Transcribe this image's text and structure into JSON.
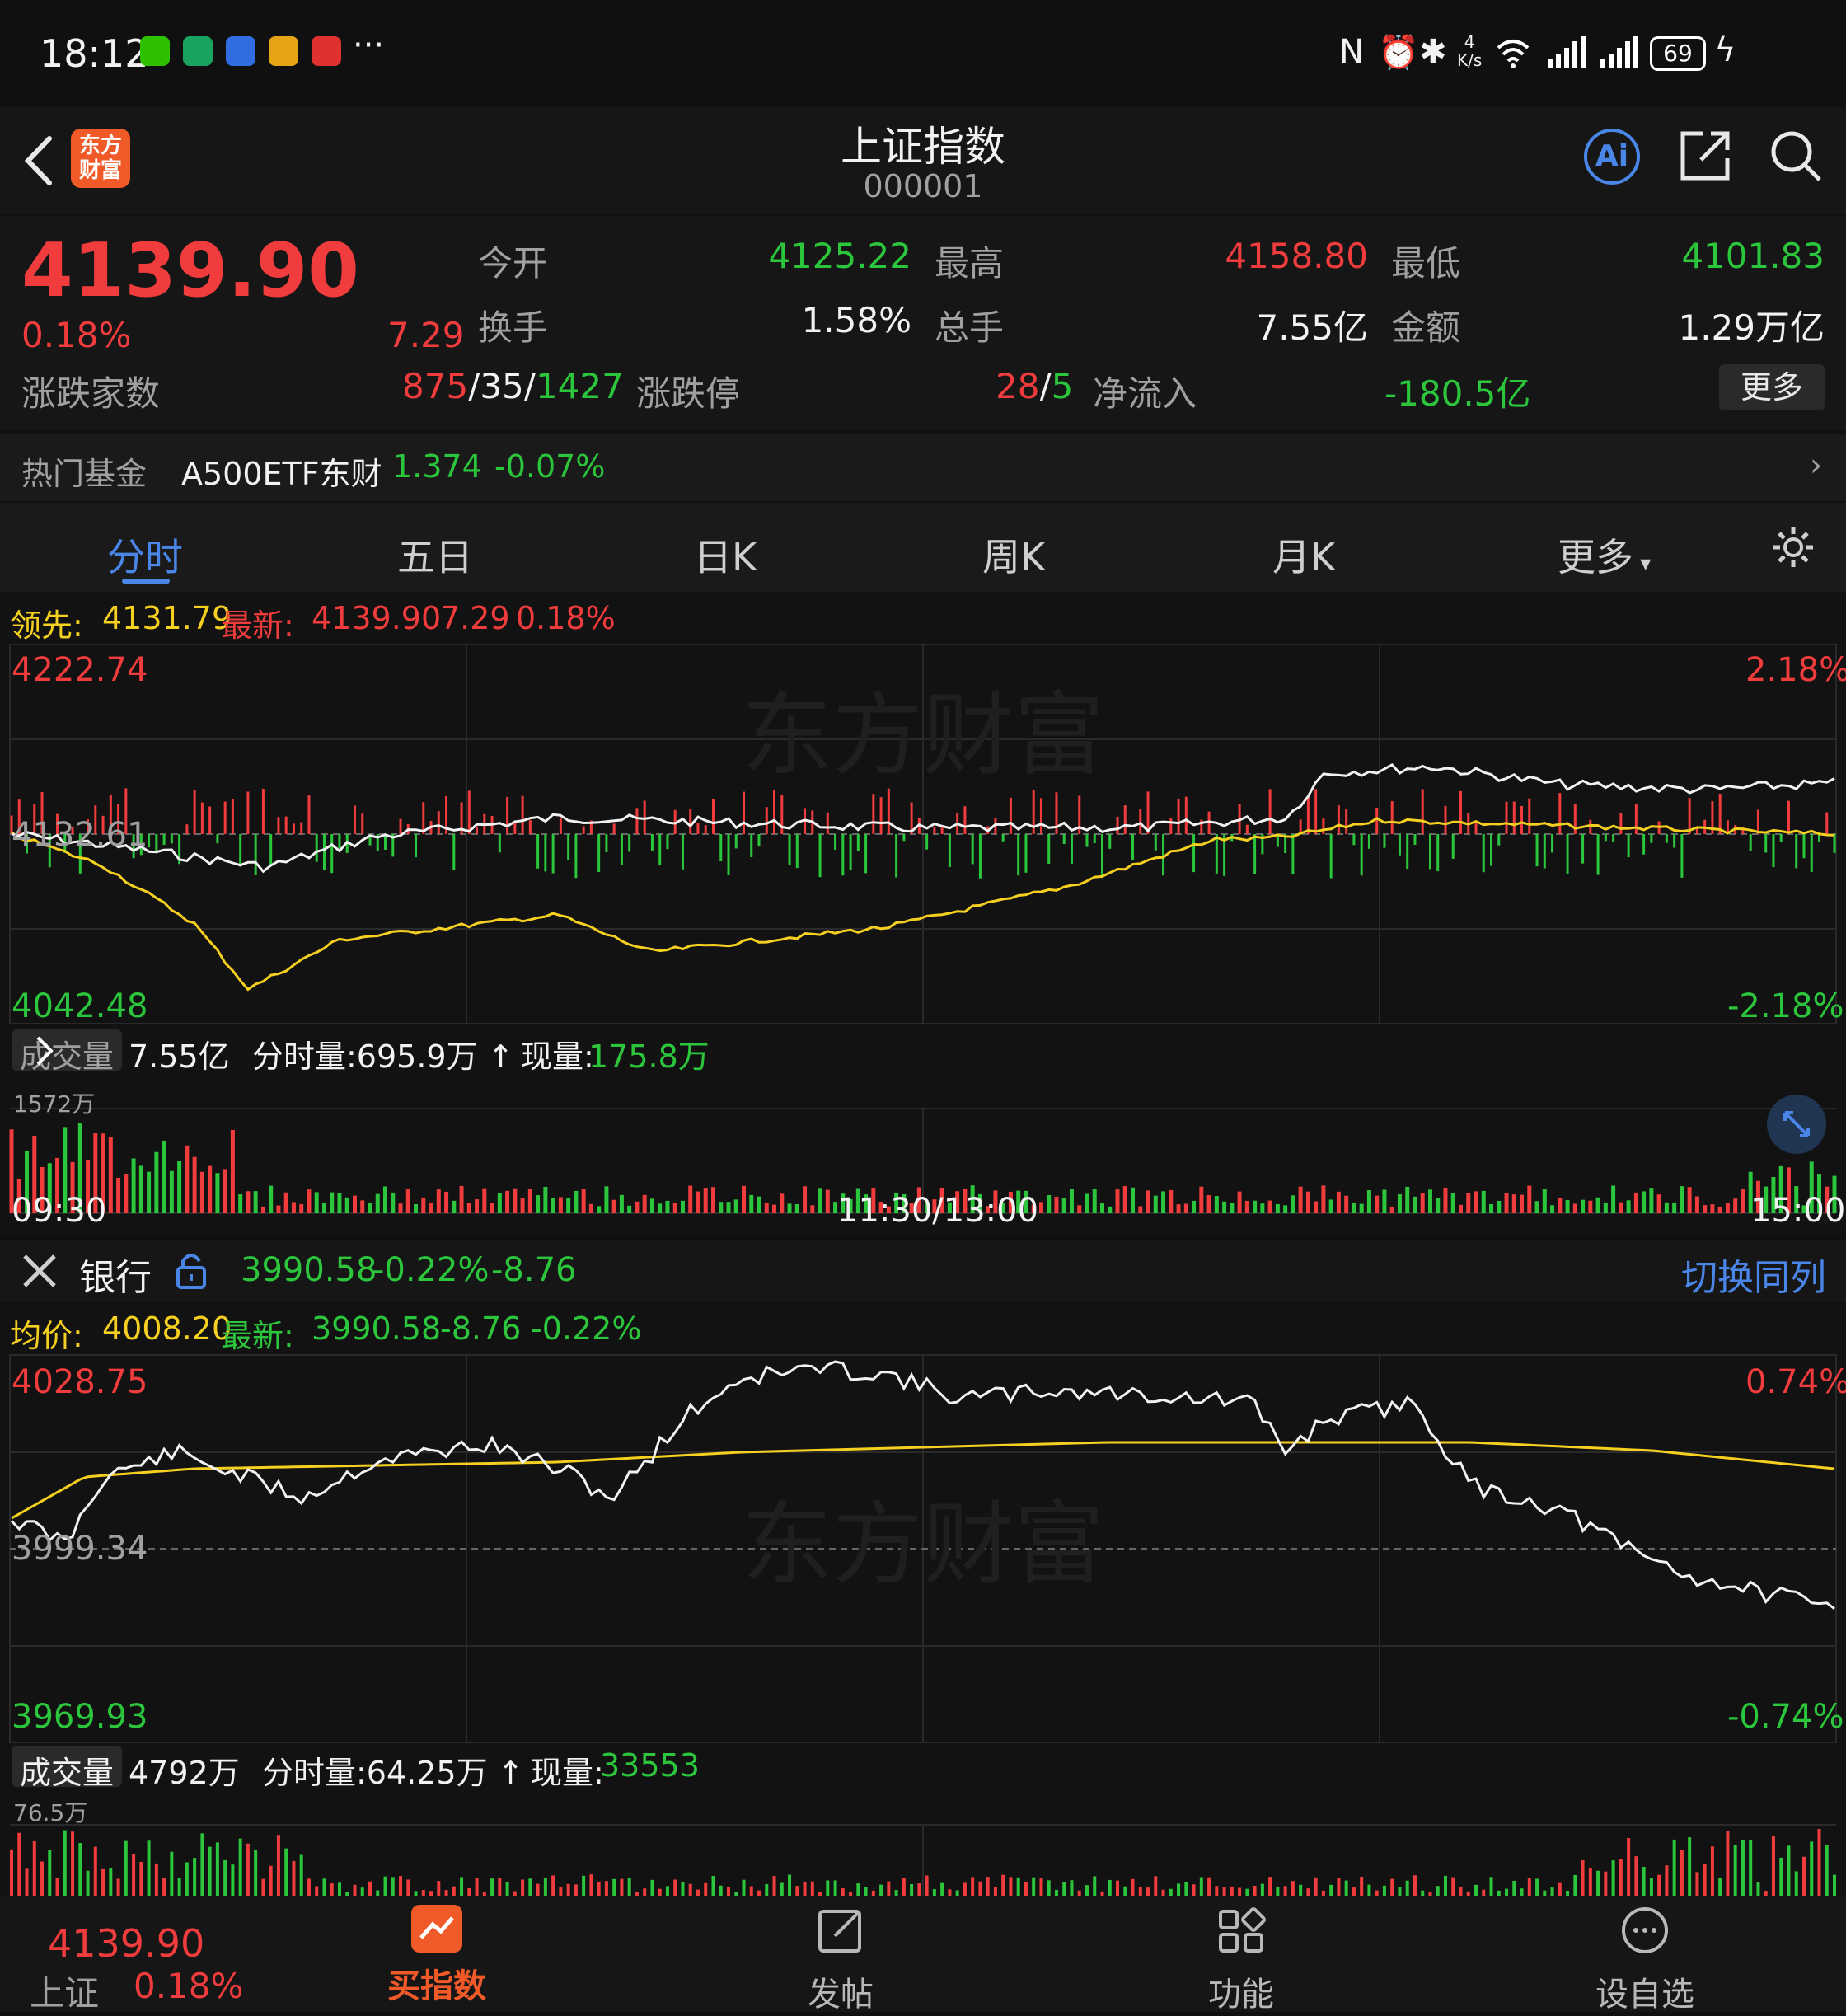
{
  "status_bar": {
    "time": "18:12",
    "net_speed_top": "4",
    "net_speed_unit": "K/s",
    "battery": "69"
  },
  "header": {
    "logo_text_1": "东方",
    "logo_text_2": "财富",
    "title": "上证指数",
    "code": "000001"
  },
  "quote": {
    "price": "4139.90",
    "change_pct": "0.18%",
    "change": "7.29",
    "open_label": "今开",
    "open": "4125.22",
    "high_label": "最高",
    "high": "4158.80",
    "low_label": "最低",
    "low": "4101.83",
    "turnover_label": "换手",
    "turnover": "1.58%",
    "volume_label": "总手",
    "volume": "7.55亿",
    "amount_label": "金额",
    "amount": "1.29万亿",
    "breadth_label": "涨跌家数",
    "breadth_up": "875",
    "breadth_flat": "35",
    "breadth_down": "1427",
    "limit_label": "涨跌停",
    "limit_up": "28",
    "limit_down": "5",
    "netflow_label": "净流入",
    "netflow": "-180.5亿",
    "more_label": "更多",
    "slash": "/"
  },
  "fund": {
    "label": "热门基金",
    "name": "A500ETF东财",
    "price": "1.374",
    "change": "-0.07%"
  },
  "tabs": [
    "分时",
    "五日",
    "日K",
    "周K",
    "月K",
    "更多"
  ],
  "chart1": {
    "lead_label": "领先:",
    "lead_value": "4131.79",
    "latest_label": "最新:",
    "latest": "4139.90",
    "chg": "7.29",
    "pct": "0.18%",
    "y_top": "4222.74",
    "y_mid": "4132.61",
    "y_bottom": "4042.48",
    "pct_top": "2.18%",
    "pct_bottom": "-2.18%",
    "vol_label": "成交量",
    "vol_total": "7.55亿",
    "vol_period_label": "分时量:695.9万",
    "vol_now_label": "现量:",
    "vol_now": "175.8万",
    "vol_max": "1572万",
    "time_start": "09:30",
    "time_mid": "11:30/13:00",
    "time_end": "15:00",
    "watermark": "东方财富"
  },
  "chart2": {
    "sector": "银行",
    "price": "3990.58",
    "pct": "-0.22%",
    "chg": "-8.76",
    "switch_label": "切换同列",
    "avg_label": "均价:",
    "avg_value": "4008.20",
    "latest_label": "最新:",
    "latest": "3990.58",
    "latest_chg": "-8.76",
    "latest_pct": "-0.22%",
    "y_top": "4028.75",
    "y_mid": "3999.34",
    "y_bottom": "3969.93",
    "pct_top": "0.74%",
    "pct_bottom": "-0.74%",
    "vol_label": "成交量",
    "vol_total": "4792万",
    "vol_period_label": "分时量:64.25万",
    "vol_now_label": "现量:",
    "vol_now": "33553",
    "vol_max": "76.5万",
    "watermark": "东方财富"
  },
  "bottom": {
    "index_price": "4139.90",
    "index_name": "上证",
    "index_pct": "0.18%",
    "buy_label": "买指数",
    "post_label": "发帖",
    "func_label": "功能",
    "watch_label": "设自选"
  },
  "colors": {
    "up": "#f03c3c",
    "down": "#2cc63c",
    "avg": "#f5d020",
    "accent": "#4a86e8",
    "bg": "#101010"
  },
  "icons": [
    "back-icon",
    "ai-icon",
    "share-icon",
    "search-icon",
    "settings-icon",
    "collapse-icon",
    "lock-icon",
    "expand-icon",
    "buy-index-icon",
    "post-icon",
    "function-icon",
    "watchlist-icon"
  ]
}
